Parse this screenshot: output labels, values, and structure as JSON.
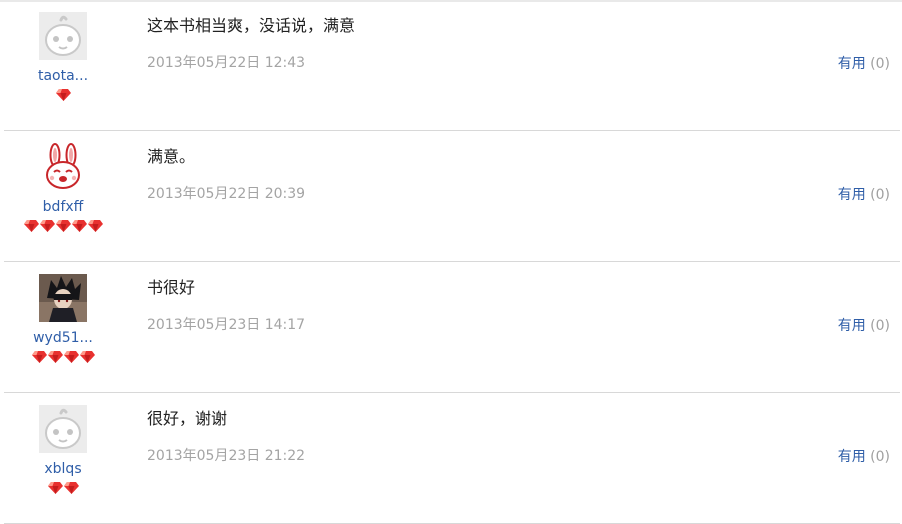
{
  "reviews": [
    {
      "username": "taota...",
      "avatar": "default-face",
      "rank_count": 1,
      "content": "这本书相当爽，没话说，满意",
      "time": "2013年05月22日 12:43",
      "useful_label": "有用",
      "useful_count": "(0)"
    },
    {
      "username": "bdfxff",
      "avatar": "rabbit",
      "rank_count": 5,
      "content": "满意。",
      "time": "2013年05月22日 20:39",
      "useful_label": "有用",
      "useful_count": "(0)"
    },
    {
      "username": "wyd51...",
      "avatar": "anime-character",
      "rank_count": 4,
      "content": "书很好",
      "time": "2013年05月23日 14:17",
      "useful_label": "有用",
      "useful_count": "(0)"
    },
    {
      "username": "xblqs",
      "avatar": "default-face",
      "rank_count": 2,
      "content": "很好，谢谢",
      "time": "2013年05月23日 21:22",
      "useful_label": "有用",
      "useful_count": "(0)"
    }
  ],
  "colors": {
    "username": "#2f5ea8",
    "useful_label": "#2f5ea8",
    "time": "#a4a4a4",
    "gem": "#e8312f"
  },
  "icons": {
    "rank_gem": "red-gem-icon"
  }
}
